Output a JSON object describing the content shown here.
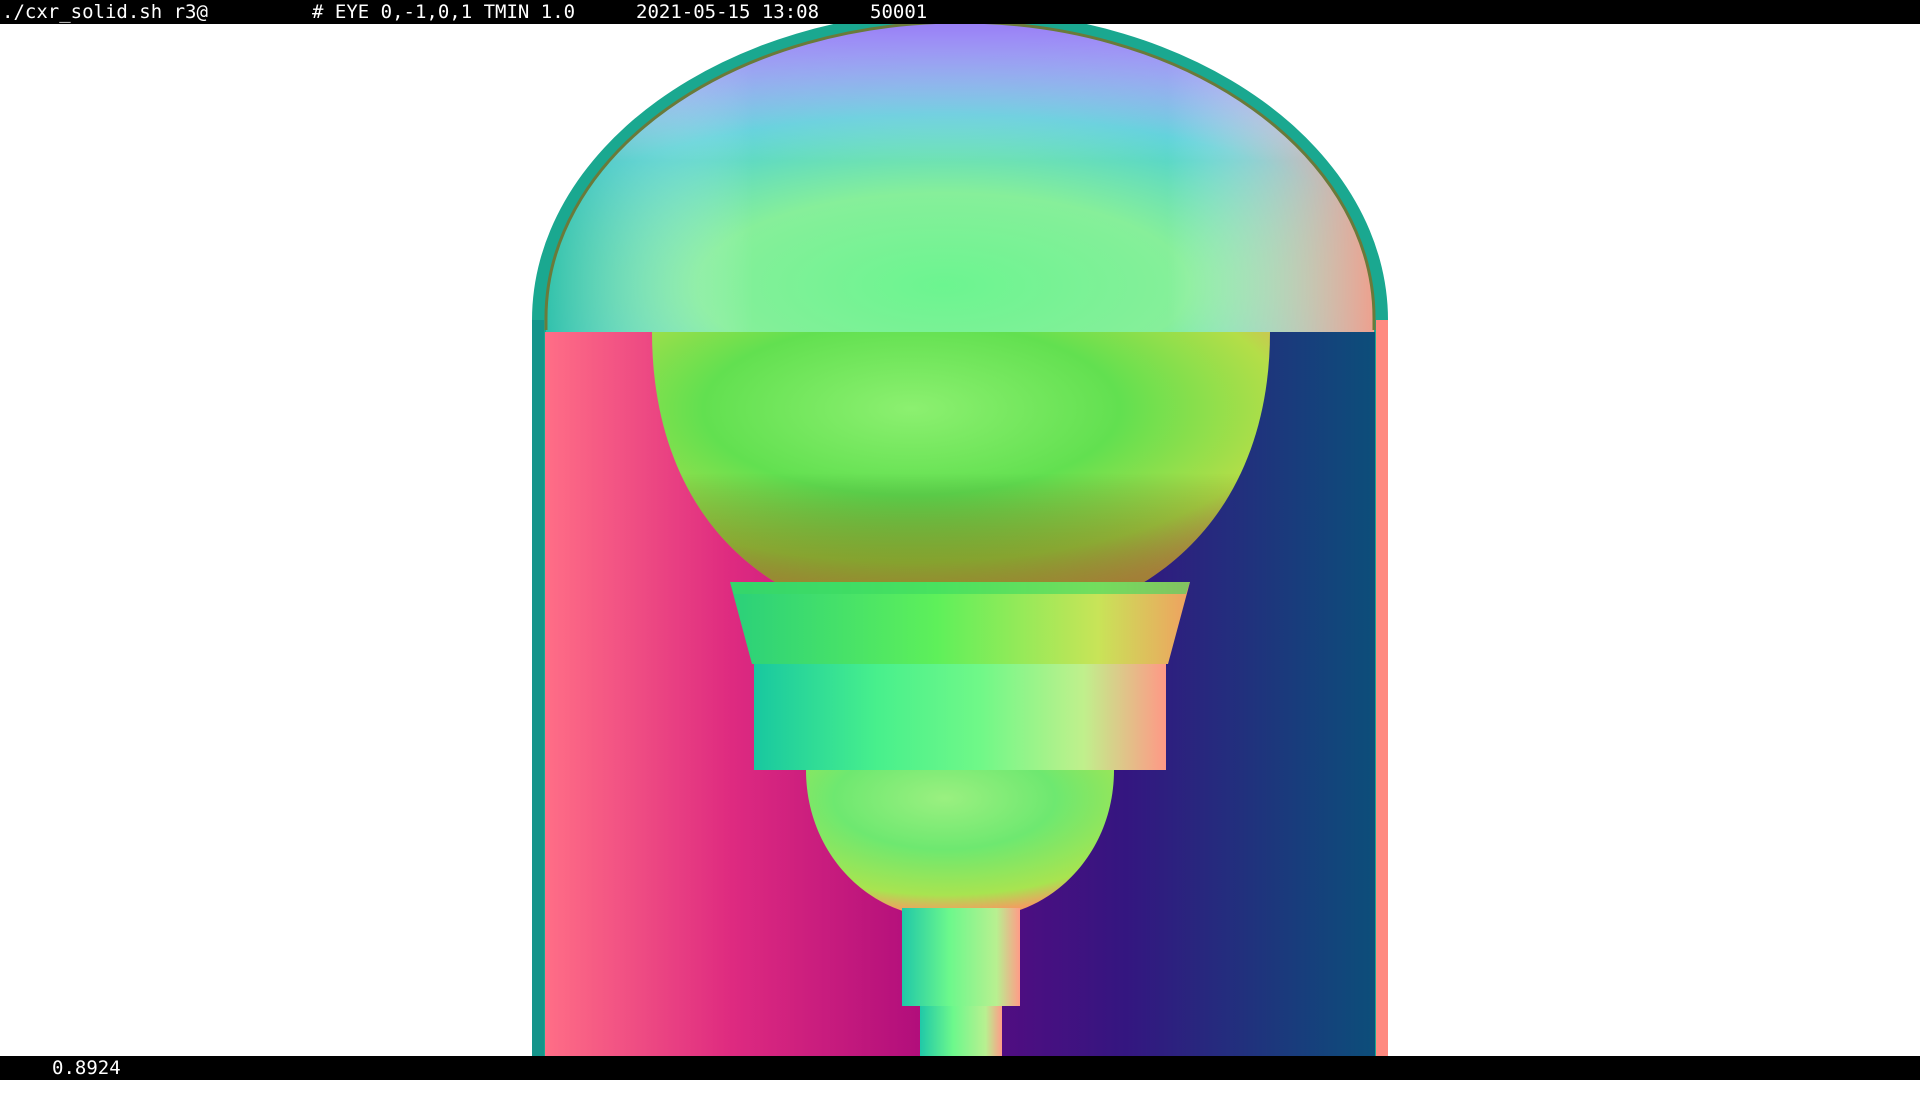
{
  "topbar": {
    "command": "./cxr_solid.sh r3@",
    "eye": "# EYE 0,-1,0,1 TMIN 1.0",
    "datetime": "2021-05-15 13:08",
    "code": "50001"
  },
  "bottombar": {
    "value": "0.8924"
  }
}
